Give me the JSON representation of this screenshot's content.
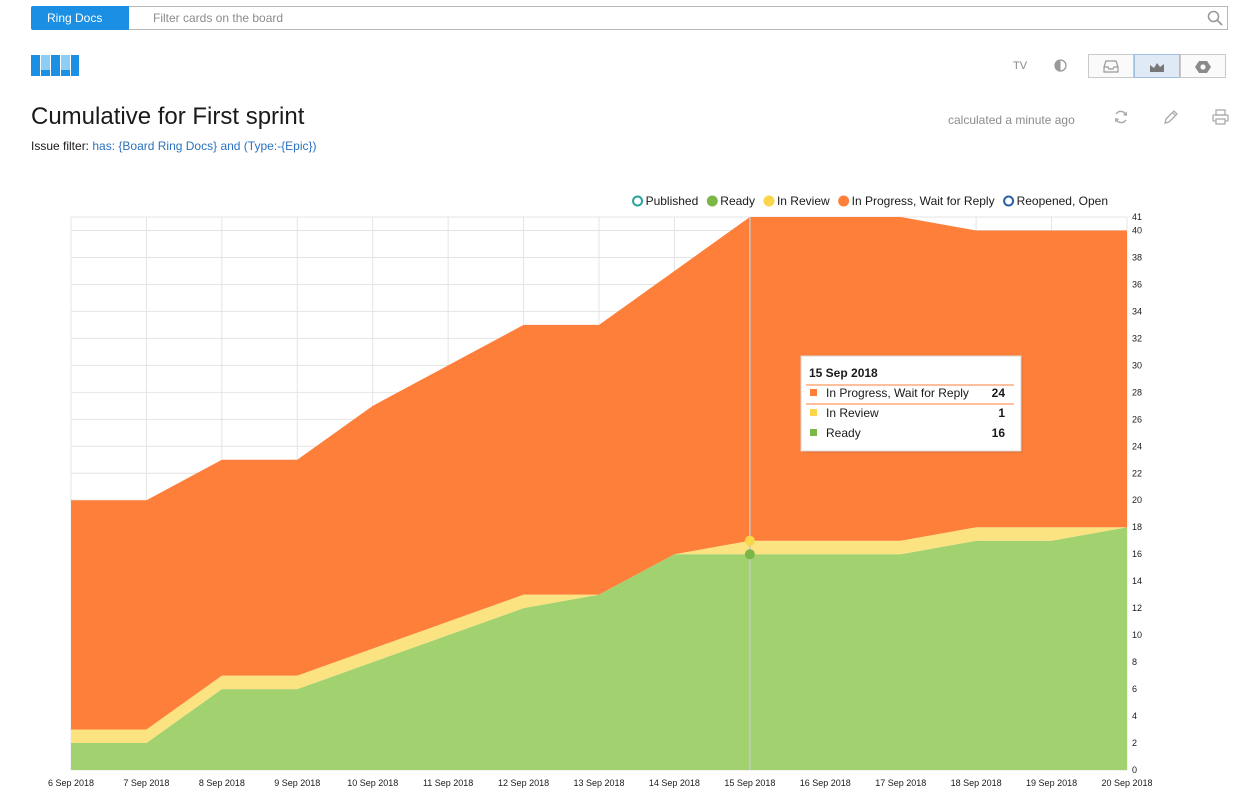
{
  "header": {
    "board_button": "Ring Docs",
    "search_placeholder": "Filter cards on the board"
  },
  "toolbar": {
    "tv_label": "TV",
    "icons": [
      "board-logo-icon",
      "contrast-icon",
      "inbox-icon",
      "chart-icon",
      "settings-icon"
    ]
  },
  "report": {
    "title": "Cumulative for First sprint",
    "filter_label": "Issue filter:",
    "filter_query": "has: {Board Ring Docs} and (Type:-{Epic})",
    "calculated": "calculated a minute ago",
    "action_icons": [
      "refresh-icon",
      "edit-icon",
      "print-icon"
    ]
  },
  "colors": {
    "ready": "#a2d16f",
    "in_review": "#fce381",
    "in_progress": "#fe7f3a",
    "published": "#27a398",
    "reopened": "#2a5fa8",
    "accent": "#1a8fe3"
  },
  "chart_data": {
    "type": "area",
    "stacked": true,
    "title": "",
    "xlabel": "",
    "ylabel": "",
    "ylim": [
      0,
      41
    ],
    "yticks": [
      0,
      2,
      4,
      6,
      8,
      10,
      12,
      14,
      16,
      18,
      20,
      22,
      24,
      26,
      28,
      30,
      32,
      34,
      36,
      38,
      40,
      41
    ],
    "grid": true,
    "legend_position": "top-right",
    "categories": [
      "6 Sep 2018",
      "7 Sep 2018",
      "8 Sep 2018",
      "9 Sep 2018",
      "10 Sep 2018",
      "11 Sep 2018",
      "12 Sep 2018",
      "13 Sep 2018",
      "14 Sep 2018",
      "15 Sep 2018",
      "16 Sep 2018",
      "17 Sep 2018",
      "18 Sep 2018",
      "19 Sep 2018",
      "20 Sep 2018"
    ],
    "legend": [
      {
        "name": "Published",
        "color": "#27a398",
        "hollow": true
      },
      {
        "name": "Ready",
        "color": "#7ab648",
        "hollow": false
      },
      {
        "name": "In Review",
        "color": "#f9d64a",
        "hollow": false
      },
      {
        "name": "In Progress, Wait for Reply",
        "color": "#fe7f3a",
        "hollow": false
      },
      {
        "name": "Reopened, Open",
        "color": "#2a5fa8",
        "hollow": true
      }
    ],
    "series": [
      {
        "name": "Ready",
        "color": "#a2d16f",
        "values": [
          2,
          2,
          6,
          6,
          8,
          10,
          12,
          13,
          16,
          16,
          16,
          16,
          17,
          17,
          18
        ]
      },
      {
        "name": "In Review",
        "color": "#fce381",
        "values": [
          1,
          1,
          1,
          1,
          1,
          1,
          1,
          0,
          0,
          1,
          1,
          1,
          1,
          1,
          0
        ]
      },
      {
        "name": "In Progress, Wait for Reply",
        "color": "#fe7f3a",
        "values": [
          17,
          17,
          16,
          16,
          18,
          19,
          20,
          20,
          21,
          24,
          24,
          24,
          22,
          22,
          22
        ]
      }
    ],
    "tooltip": {
      "date": "15 Sep 2018",
      "index": 9,
      "rows": [
        {
          "name": "In Progress, Wait for Reply",
          "value": "24",
          "color": "#fe7f3a"
        },
        {
          "name": "In Review",
          "value": "1",
          "color": "#f9d64a"
        },
        {
          "name": "Ready",
          "value": "16",
          "color": "#7ab648"
        }
      ]
    }
  }
}
